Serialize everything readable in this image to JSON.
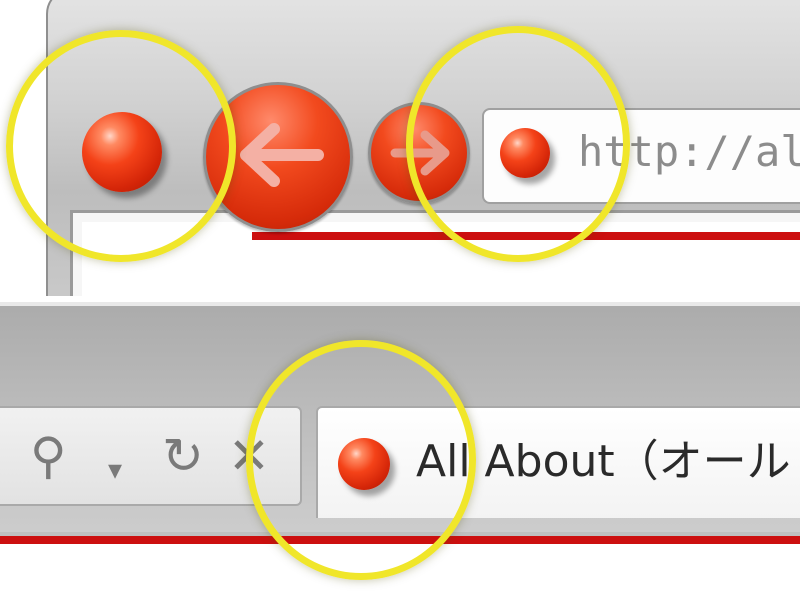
{
  "top_toolbar": {
    "app_icon": "red-ball-site-icon",
    "back_icon": "back-arrow-icon",
    "forward_icon": "forward-arrow-icon",
    "address_bar": {
      "favicon": "red-ball-favicon",
      "url_partial": "http://alla"
    }
  },
  "tab_strip": {
    "tools": {
      "search_icon": "⚲",
      "dropdown_icon": "▾",
      "refresh_icon": "↻",
      "stop_icon": "✕"
    },
    "active_tab": {
      "favicon": "red-ball-favicon",
      "title": "All About（オール"
    }
  },
  "highlights": [
    "app-icon",
    "address-bar-favicon",
    "tab-favicon"
  ],
  "colors": {
    "accent_red": "#cc0f0f",
    "highlight_yellow": "#f0e62a",
    "favicon_red": "#e8340c"
  }
}
